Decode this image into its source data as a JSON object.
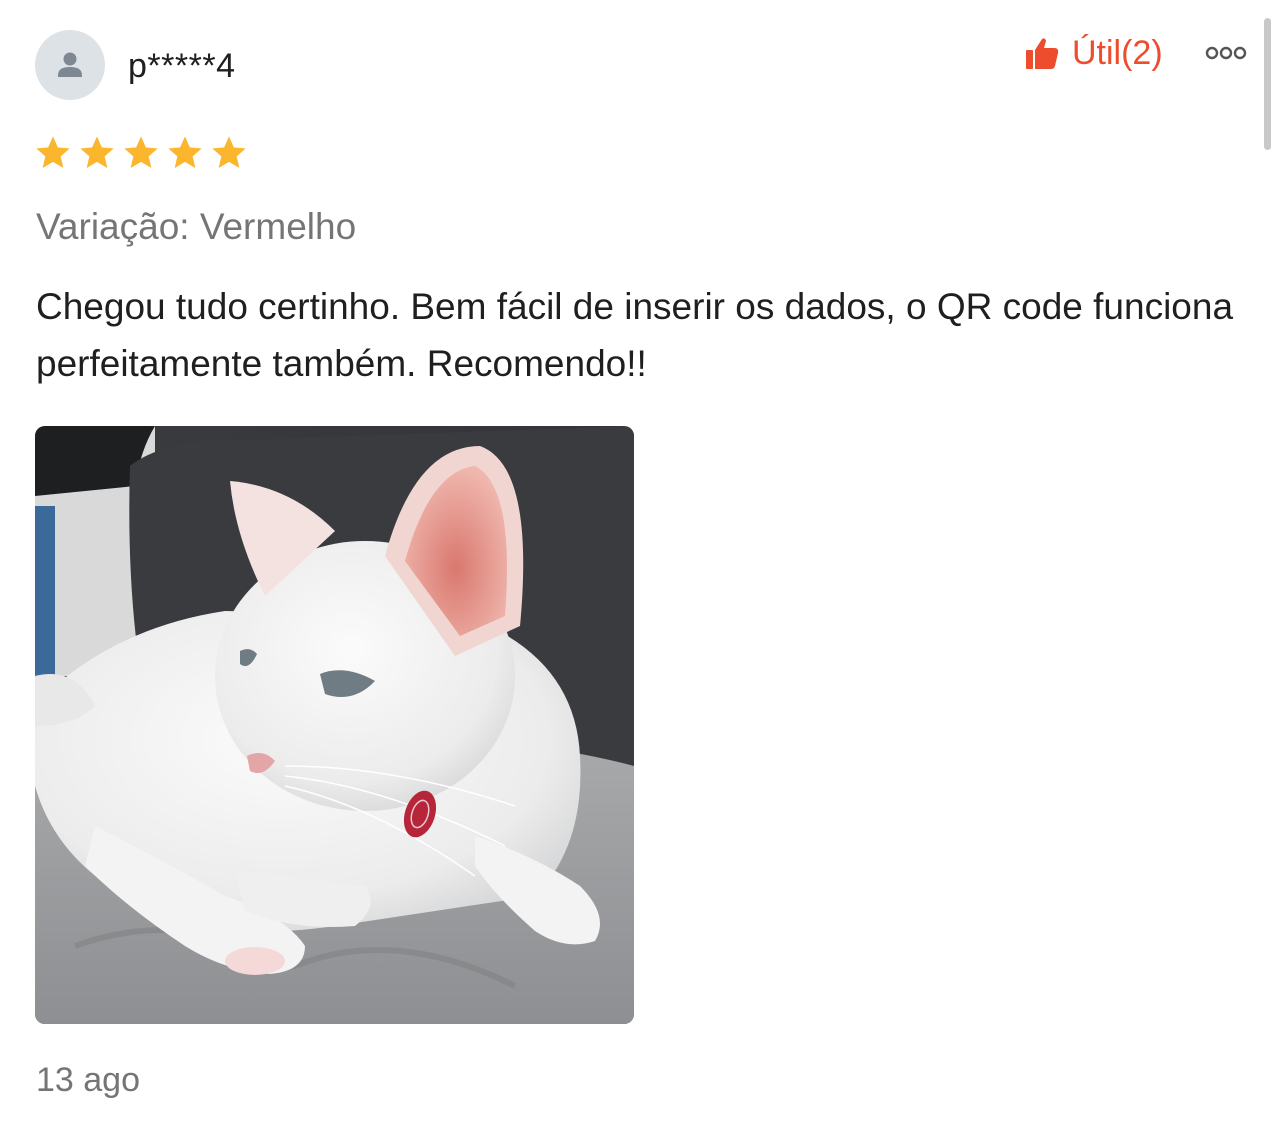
{
  "review": {
    "username": "p*****4",
    "rating": 5,
    "rating_max": 5,
    "helpful_label": "Útil(2)",
    "variation": "Variação: Vermelho",
    "text": "Chegou tudo certinho. Bem fácil de inserir os dados, o QR code funciona perfeitamente também. Recomendo!!",
    "date": "13 ago"
  },
  "icons": {
    "avatar": "user-icon",
    "helpful": "thumbs-up-icon",
    "more": "more-options-icon",
    "star": "star-icon"
  },
  "colors": {
    "accent": "#ee4d2d",
    "star": "#fbb62e",
    "muted_text": "#757575",
    "avatar_bg": "#dde2e7"
  }
}
